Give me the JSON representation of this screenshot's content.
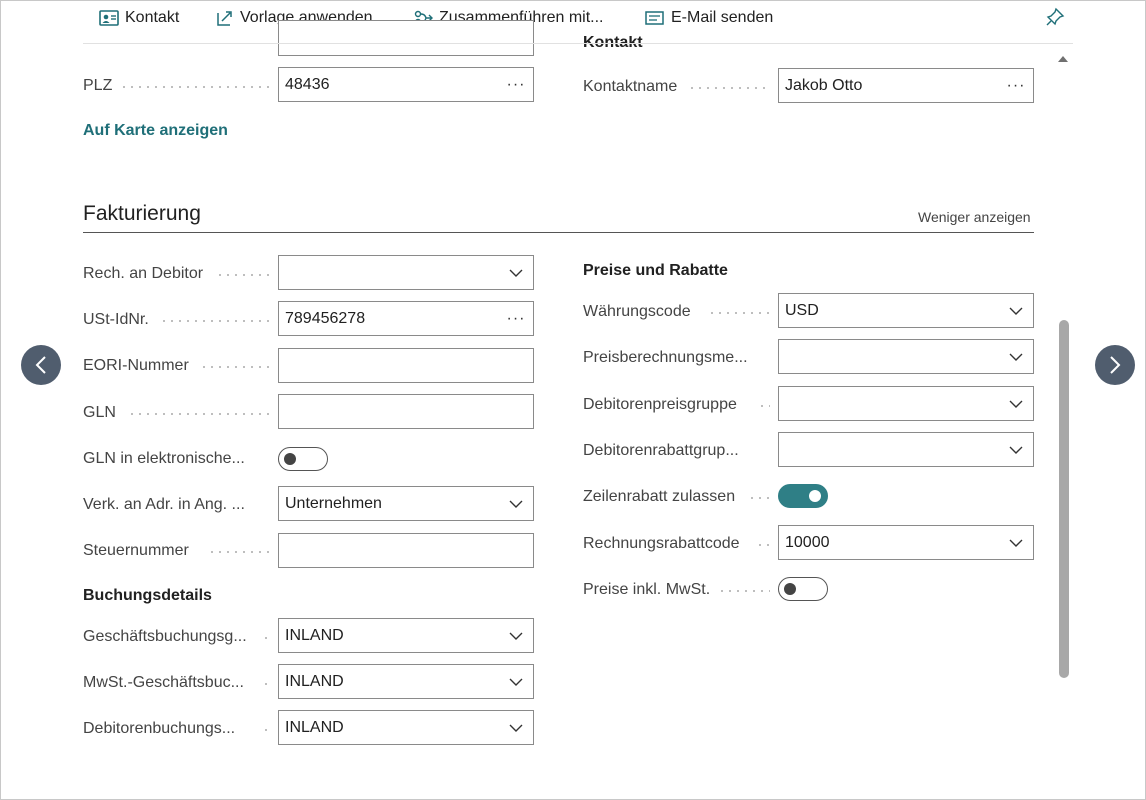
{
  "toolbar": {
    "contact": "Kontakt",
    "apply_template": "Vorlage anwenden",
    "merge": "Zusammenführen mit...",
    "send_email": "E-Mail senden"
  },
  "top": {
    "zip_label": "PLZ",
    "zip_value": "48436",
    "map_link": "Auf Karte anzeigen",
    "contact_section": "Kontakt",
    "contact_name_label": "Kontaktname",
    "contact_name_value": "Jakob Otto"
  },
  "billing": {
    "title": "Fakturierung",
    "show_less": "Weniger anzeigen",
    "bill_to_label": "Rech. an Debitor",
    "bill_to_value": "",
    "vat_id_label": "USt-IdNr.",
    "vat_id_value": "789456278",
    "eori_label": "EORI-Nummer",
    "eori_value": "",
    "gln_label": "GLN",
    "gln_value": "",
    "gln_electronic_label": "GLN in elektronische...",
    "gln_electronic_on": false,
    "ship_addr_label": "Verk. an Adr. in Ang. ...",
    "ship_addr_value": "Unternehmen",
    "tax_no_label": "Steuernummer",
    "tax_no_value": ""
  },
  "posting": {
    "title": "Buchungsdetails",
    "gen_bus_label": "Geschäftsbuchungsg...",
    "gen_bus_value": "INLAND",
    "vat_bus_label": "MwSt.-Geschäftsbuc...",
    "vat_bus_value": "INLAND",
    "customer_posting_label": "Debitorenbuchungs...",
    "customer_posting_value": "INLAND"
  },
  "prices": {
    "title": "Preise und Rabatte",
    "currency_label": "Währungscode",
    "currency_value": "USD",
    "price_calc_label": "Preisberechnungsme...",
    "price_calc_value": "",
    "price_group_label": "Debitorenpreisgruppe",
    "price_group_value": "",
    "discount_group_label": "Debitorenrabattgrup...",
    "discount_group_value": "",
    "line_discount_label": "Zeilenrabatt zulassen",
    "line_discount_on": true,
    "invoice_discount_label": "Rechnungsrabattcode",
    "invoice_discount_value": "10000",
    "prices_incl_vat_label": "Preise inkl. MwSt.",
    "prices_incl_vat_on": false
  },
  "colors": {
    "accent": "#2f7f86",
    "nav_button": "#505d6e"
  }
}
